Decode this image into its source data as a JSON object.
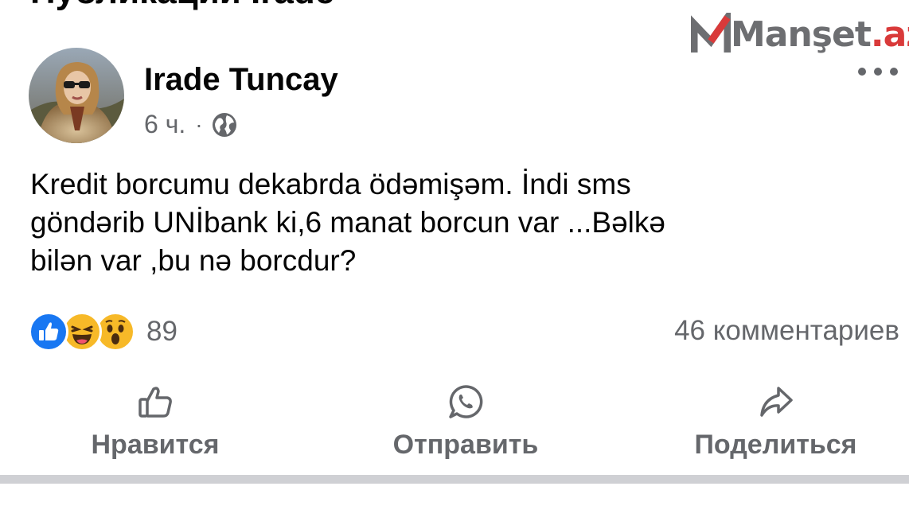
{
  "header": {
    "cut_heading": "Публикации Irade"
  },
  "watermark": {
    "text_gray": "Manşet",
    "text_red": ".az"
  },
  "post": {
    "author": "Irade Tuncay",
    "time": "6 ч.",
    "separator": "·",
    "audience_icon": "globe-icon",
    "text_lines": [
      "Kredit borcumu dekabrda ödəmişəm. İndi sms",
      "göndərib UNİbank ki,6 manat borcun var ...Bəlkə",
      "bilən var ,bu nə borcdur?"
    ],
    "reaction_icons": [
      "like-reaction-icon",
      "haha-reaction-icon",
      "wow-reaction-icon"
    ],
    "reaction_count": "89",
    "comments": "46 комментариев"
  },
  "actions": {
    "like": "Нравится",
    "send": "Отправить",
    "share": "Поделиться"
  },
  "colors": {
    "text_primary": "#050505",
    "text_secondary": "#65676b",
    "like_blue": "#1877f2",
    "emoji_yellow": "#f7b928",
    "brand_red": "#d93a3a",
    "brand_gray": "#6d6e71",
    "divider": "#cfd0d4"
  }
}
